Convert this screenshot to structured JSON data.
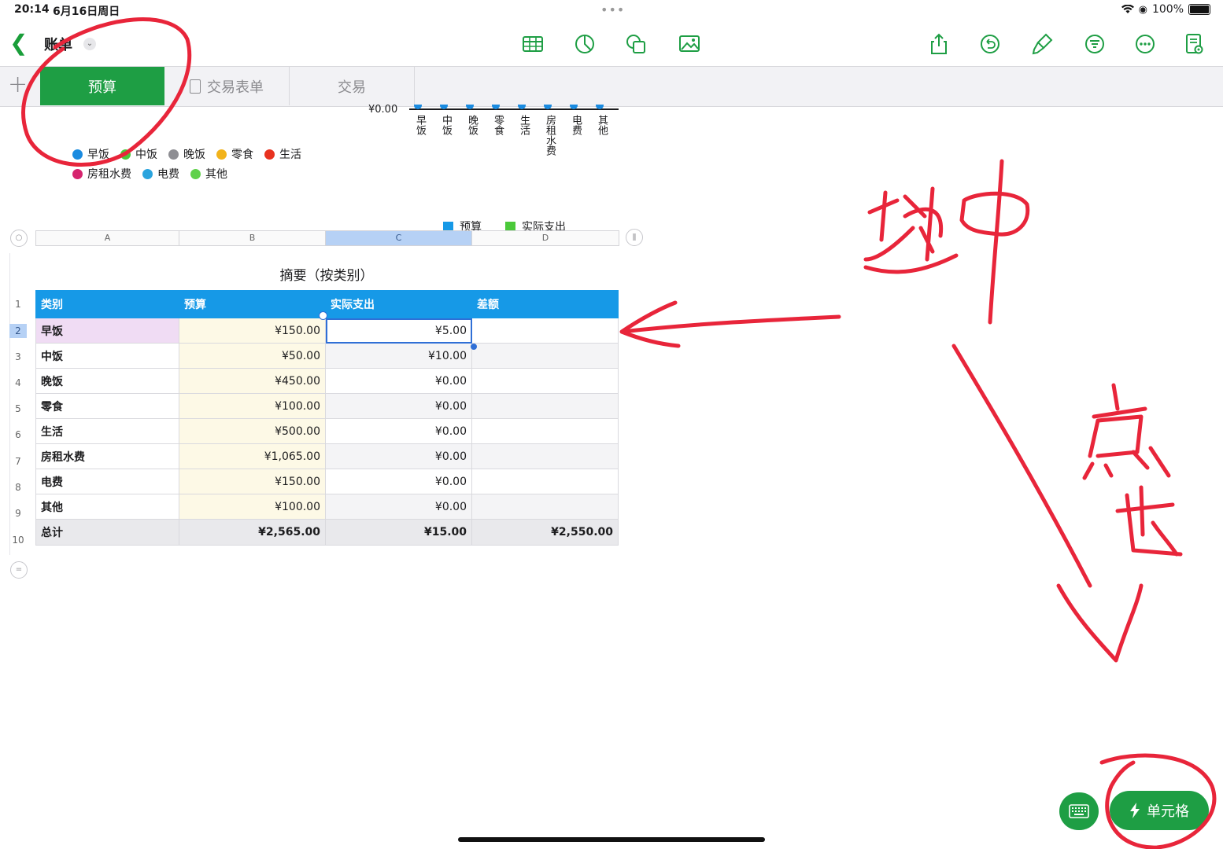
{
  "status": {
    "time": "20:14",
    "date": "6月16日周日",
    "battery": "100%"
  },
  "toolbar": {
    "title": "账单",
    "left_icons": [
      "table-icon",
      "chart-icon",
      "shape-icon",
      "media-icon"
    ],
    "right_icons": [
      "share-icon",
      "undo-icon",
      "format-brush-icon",
      "organize-icon",
      "more-icon",
      "document-icon"
    ]
  },
  "tabs": [
    {
      "label": "预算",
      "active": true
    },
    {
      "label": "交易表单",
      "active": false
    },
    {
      "label": "交易",
      "active": false
    }
  ],
  "chart": {
    "axis_value": "¥0.00",
    "x_labels": [
      "早饭",
      "中饭",
      "晚饭",
      "零食",
      "生活",
      "房租水费",
      "电费",
      "其他"
    ],
    "pie_legend": [
      {
        "label": "早饭",
        "color": "#1a8be0"
      },
      {
        "label": "中饭",
        "color": "#4bc93a"
      },
      {
        "label": "晚饭",
        "color": "#8e8e93"
      },
      {
        "label": "零食",
        "color": "#f2b31b"
      },
      {
        "label": "生活",
        "color": "#e8321f"
      },
      {
        "label": "房租水费",
        "color": "#d6246e"
      },
      {
        "label": "电费",
        "color": "#2aa4de"
      },
      {
        "label": "其他",
        "color": "#5fd14a"
      }
    ],
    "bar_legend": [
      {
        "label": "预算",
        "color": "#1699e7"
      },
      {
        "label": "实际支出",
        "color": "#4bc93a"
      }
    ]
  },
  "sheet": {
    "columns": [
      "A",
      "B",
      "C",
      "D"
    ],
    "row_numbers": [
      "1",
      "2",
      "3",
      "4",
      "5",
      "6",
      "7",
      "8",
      "9",
      "10"
    ],
    "title": "摘要（按类别）",
    "headers": [
      "类别",
      "预算",
      "实际支出",
      "差额"
    ],
    "rows": [
      {
        "category": "早饭",
        "budget": "¥150.00",
        "actual": "¥5.00",
        "diff": ""
      },
      {
        "category": "中饭",
        "budget": "¥50.00",
        "actual": "¥10.00",
        "diff": ""
      },
      {
        "category": "晚饭",
        "budget": "¥450.00",
        "actual": "¥0.00",
        "diff": ""
      },
      {
        "category": "零食",
        "budget": "¥100.00",
        "actual": "¥0.00",
        "diff": ""
      },
      {
        "category": "生活",
        "budget": "¥500.00",
        "actual": "¥0.00",
        "diff": ""
      },
      {
        "category": "房租水费",
        "budget": "¥1,065.00",
        "actual": "¥0.00",
        "diff": ""
      },
      {
        "category": "电费",
        "budget": "¥150.00",
        "actual": "¥0.00",
        "diff": ""
      },
      {
        "category": "其他",
        "budget": "¥100.00",
        "actual": "¥0.00",
        "diff": ""
      }
    ],
    "total": {
      "category": "总计",
      "budget": "¥2,565.00",
      "actual": "¥15.00",
      "diff": "¥2,550.00"
    }
  },
  "bottom": {
    "cell_button": "单元格"
  },
  "annotation_colors": {
    "ink": "#e8253a"
  }
}
